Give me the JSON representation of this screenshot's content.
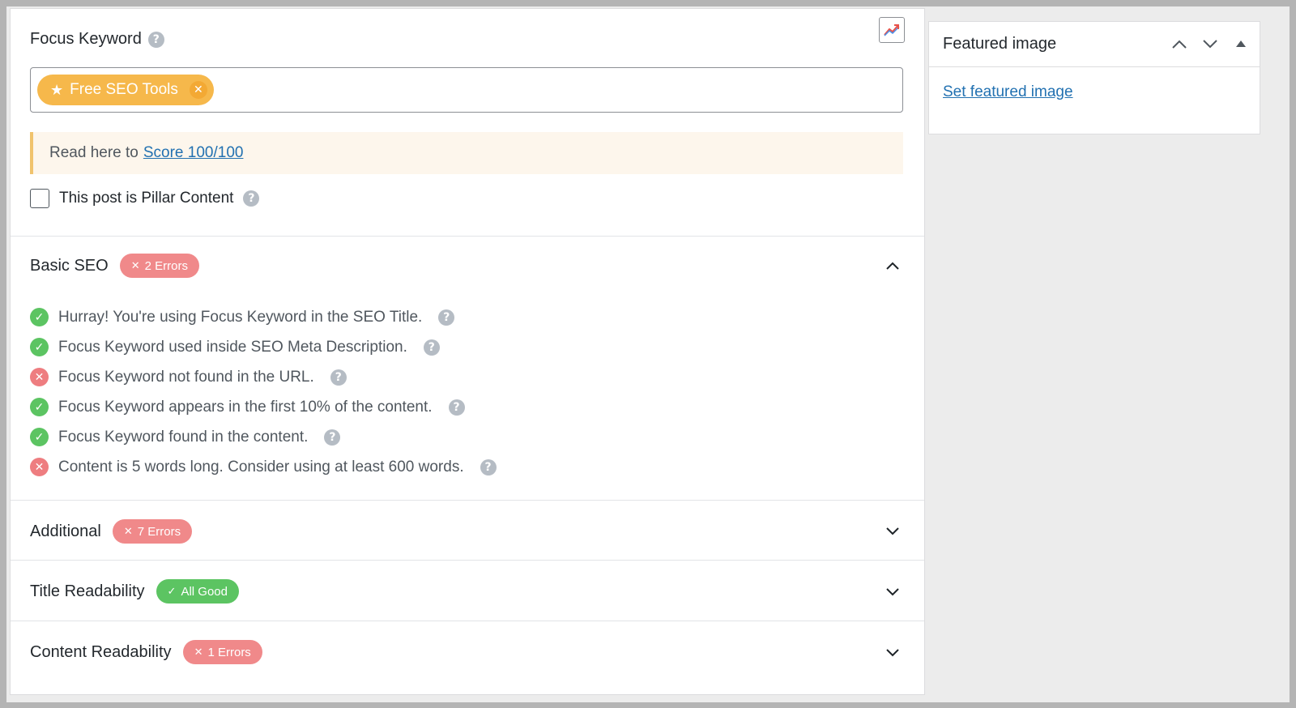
{
  "focus_keyword": {
    "label": "Focus Keyword",
    "help_icon": "question-icon",
    "keyword_tag": "Free SEO Tools",
    "tag_icon": "star-icon",
    "remove_icon": "close-icon",
    "trend_icon": "trend-chart-icon"
  },
  "notice": {
    "text": "Read here to",
    "link": "Score 100/100"
  },
  "pillar": {
    "label": "This post is Pillar Content",
    "checked": false
  },
  "sections": [
    {
      "title": "Basic SEO",
      "badge": "2 Errors",
      "badge_type": "error",
      "expanded": true
    },
    {
      "title": "Additional",
      "badge": "7 Errors",
      "badge_type": "error",
      "expanded": false
    },
    {
      "title": "Title Readability",
      "badge": "All Good",
      "badge_type": "ok",
      "expanded": false
    },
    {
      "title": "Content Readability",
      "badge": "1 Errors",
      "badge_type": "error",
      "expanded": false
    }
  ],
  "basic_seo_tests": [
    {
      "text": "Hurray! You're using Focus Keyword in the SEO Title.",
      "status": "pass"
    },
    {
      "text": "Focus Keyword used inside SEO Meta Description.",
      "status": "pass"
    },
    {
      "text": "Focus Keyword not found in the URL.",
      "status": "fail"
    },
    {
      "text": "Focus Keyword appears in the first 10% of the content.",
      "status": "pass"
    },
    {
      "text": "Focus Keyword found in the content.",
      "status": "pass"
    },
    {
      "text": "Content is 5 words long. Consider using at least 600 words.",
      "status": "fail"
    }
  ],
  "featured_image": {
    "title": "Featured image",
    "link": "Set featured image"
  },
  "colors": {
    "keyword_tag": "#f6b84b",
    "error_badge": "#f0898a",
    "ok_badge": "#5cc462",
    "pass": "#5cc462",
    "fail": "#ee7d80",
    "link": "#2271b1"
  }
}
